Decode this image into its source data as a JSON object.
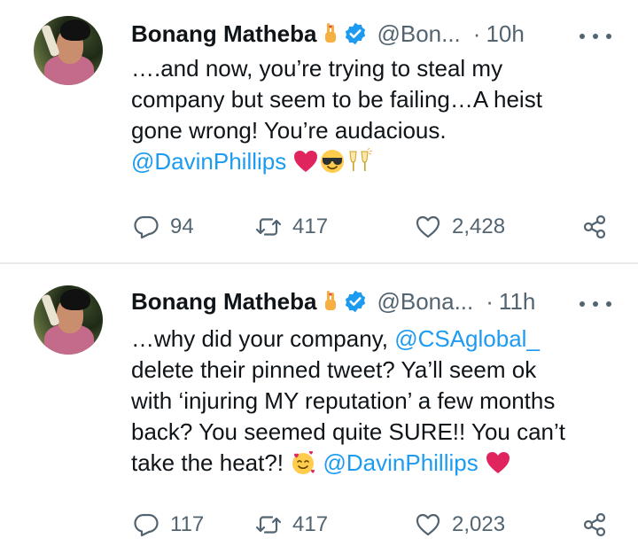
{
  "tweets": [
    {
      "author_name": "Bonang Matheba",
      "handle": "@Bon...",
      "separator": "·",
      "time": "10h",
      "lines": [
        {
          "text": "….and now, you’re trying to steal my"
        },
        {
          "text": "company but seem to be failing…A heist"
        },
        {
          "text": "gone wrong! You’re audacious."
        },
        {
          "mention": "@DavinPhillips"
        }
      ],
      "replies": "94",
      "retweets": "417",
      "likes": "2,428"
    },
    {
      "author_name": "Bonang Matheba",
      "handle": "@Bona...",
      "separator": "·",
      "time": "11h",
      "line1_text": "…why did your company, ",
      "line1_mention": "@CSAglobal_",
      "line2": "delete their pinned tweet? Ya’ll seem ok",
      "line3": "with ‘injuring MY reputation’ a few months",
      "line4": "back? You seemed quite SURE!!  You can’t",
      "line5_text": "take the heat?! ",
      "line5_mention": "@DavinPhillips",
      "replies": "117",
      "retweets": "417",
      "likes": "2,023"
    }
  ],
  "colors": {
    "text": "#0f1419",
    "secondary": "#536471",
    "mention": "#1d9bf0",
    "verified": "#1d9bf0",
    "heart_emoji": "#e0245e"
  },
  "icons": {
    "verified": "verified-badge-icon",
    "reply": "reply-icon",
    "retweet": "retweet-icon",
    "like": "heart-outline-icon",
    "share": "share-icon",
    "more": "more-dots-icon"
  }
}
